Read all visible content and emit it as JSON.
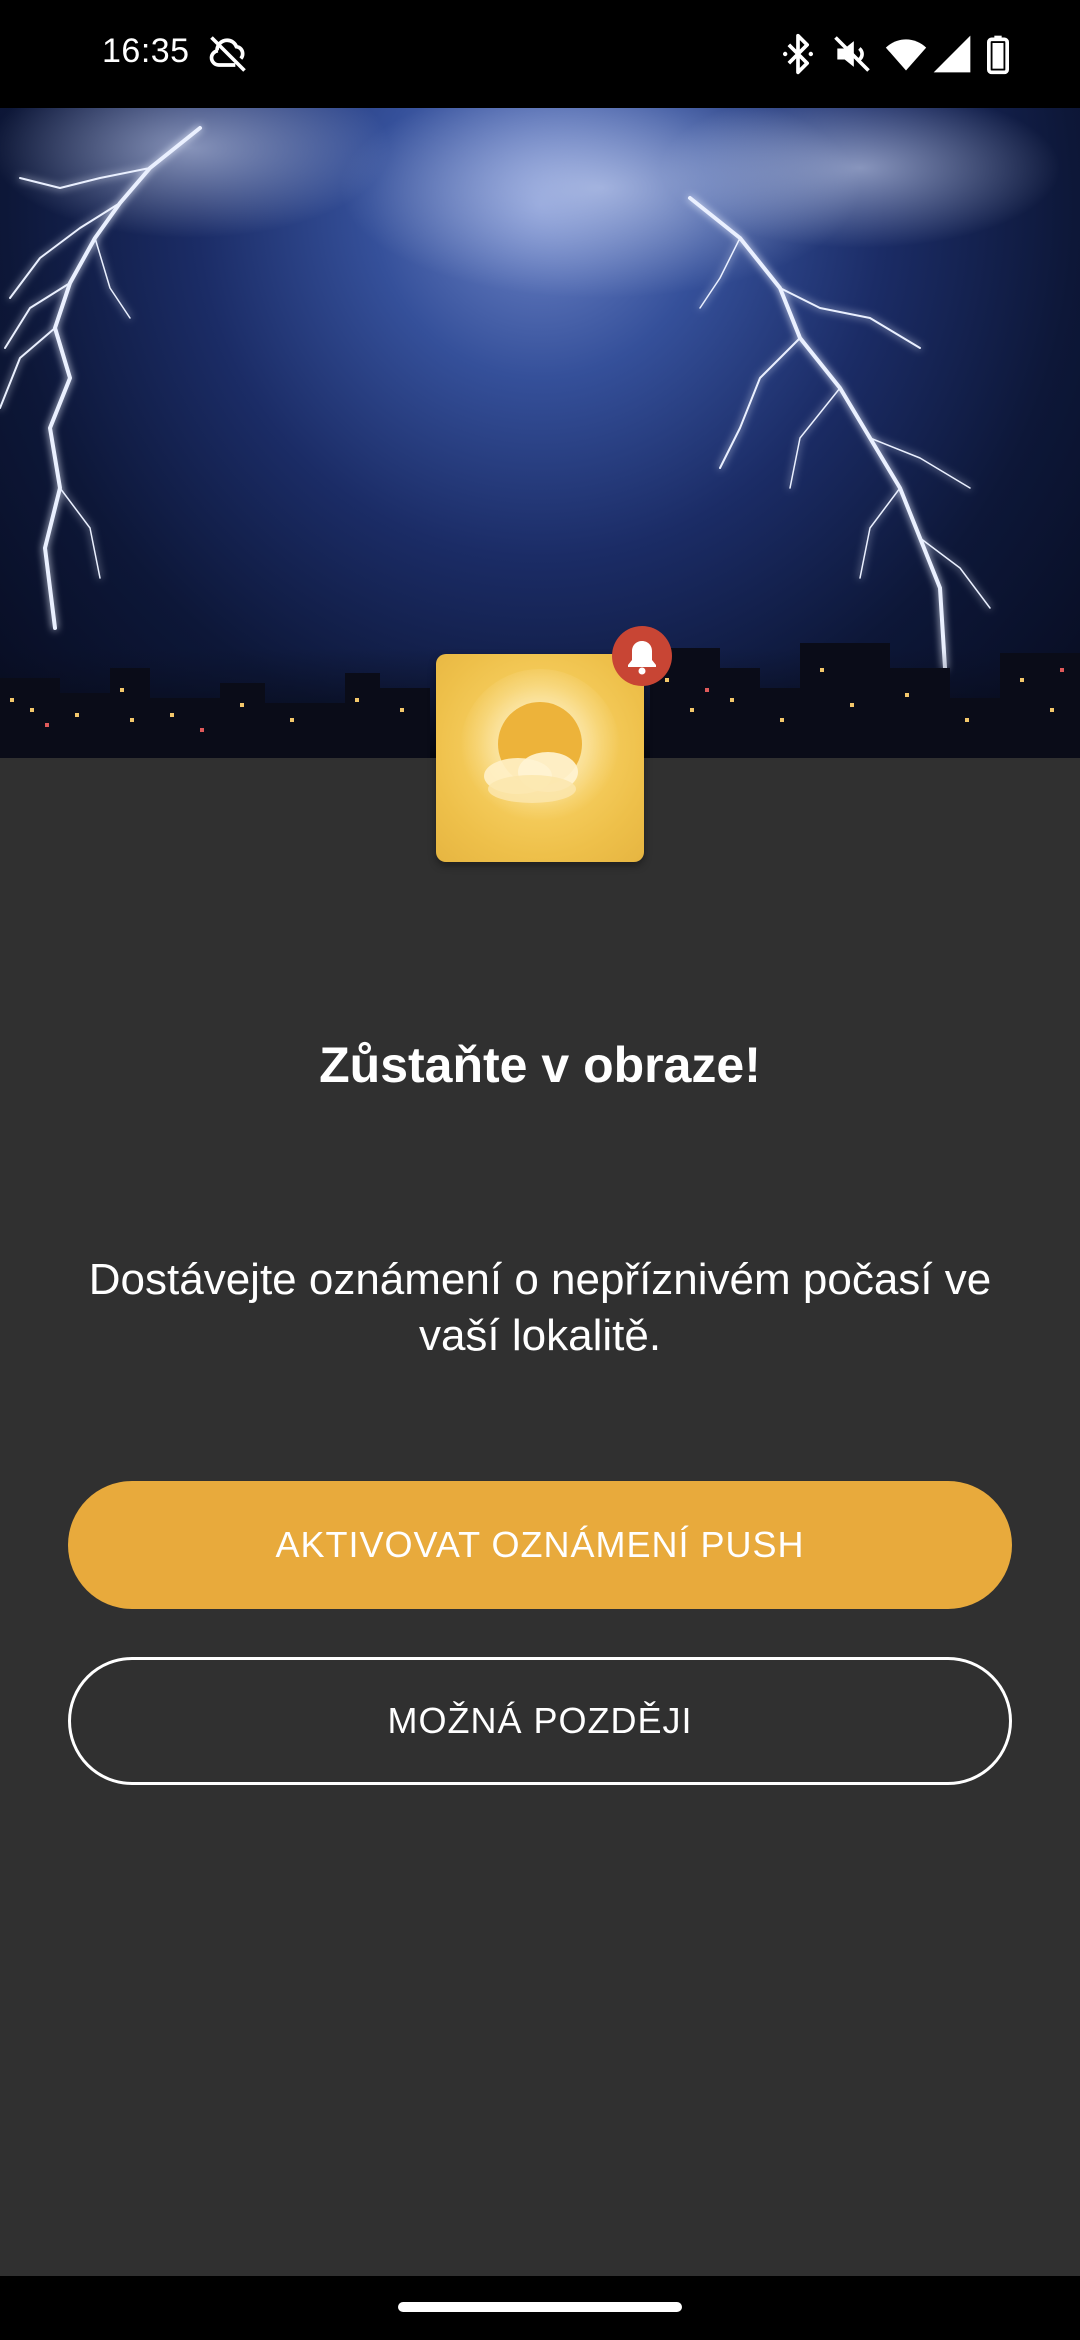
{
  "status_bar": {
    "time": "16:35",
    "icons": [
      "sync-off-icon",
      "bluetooth-icon",
      "volume-mute-icon",
      "wifi-icon",
      "cellular-signal-icon",
      "battery-icon"
    ]
  },
  "hero": {
    "image": "thunderstorm-city-night"
  },
  "app_icon": {
    "icon": "sun-behind-clouds-icon",
    "badge_icon": "bell-icon"
  },
  "content": {
    "headline": "Zůstaňte v obraze!",
    "description": "Dostávejte oznámení o nepříznivém počasí ve vaší lokalitě."
  },
  "buttons": {
    "primary_label": "AKTIVOVAT OZNÁMENÍ PUSH",
    "secondary_label": "MOŽNÁ POZDĚJI"
  },
  "colors": {
    "background": "#303030",
    "accent": "#e8aa3c",
    "badge": "#c84534",
    "icon_yellow": "#f1c34e"
  }
}
